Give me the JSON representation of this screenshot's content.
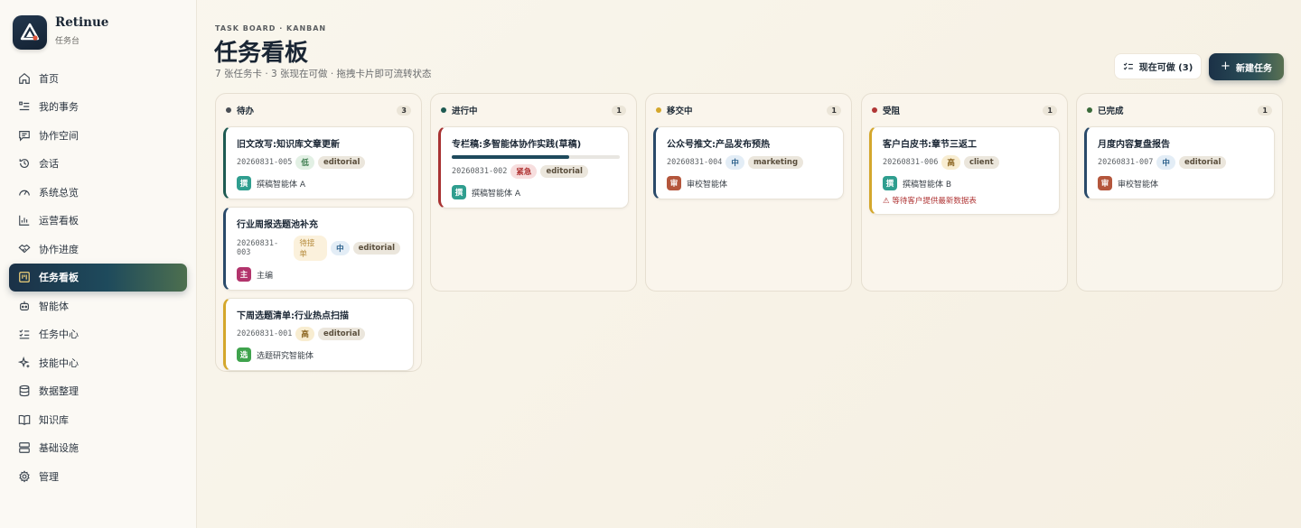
{
  "app": {
    "name": "Retinue",
    "subtitle": "任务台"
  },
  "sidebar": {
    "items": [
      {
        "label": "首页",
        "icon": "home-icon"
      },
      {
        "label": "我的事务",
        "icon": "list-icon"
      },
      {
        "label": "协作空间",
        "icon": "chat-icon"
      },
      {
        "label": "会话",
        "icon": "history-icon"
      },
      {
        "label": "系统总览",
        "icon": "gauge-icon"
      },
      {
        "label": "运营看板",
        "icon": "bar-chart-icon"
      },
      {
        "label": "协作进度",
        "icon": "handshake-icon"
      },
      {
        "label": "任务看板",
        "icon": "kanban-icon",
        "active": true
      },
      {
        "label": "智能体",
        "icon": "bot-icon"
      },
      {
        "label": "任务中心",
        "icon": "checklist-icon"
      },
      {
        "label": "技能中心",
        "icon": "sparkles-icon"
      },
      {
        "label": "数据整理",
        "icon": "database-icon"
      },
      {
        "label": "知识库",
        "icon": "book-icon"
      },
      {
        "label": "基础设施",
        "icon": "server-icon"
      },
      {
        "label": "管理",
        "icon": "gear-icon"
      }
    ]
  },
  "header": {
    "eyebrow": "TASK BOARD · KANBAN",
    "title": "任务看板",
    "subtitle": "7 张任务卡 · 3 张现在可做 · 拖拽卡片即可流转状态",
    "now_button": "现在可做 (3)",
    "new_button": "新建任务"
  },
  "board": {
    "columns": [
      {
        "name": "待办",
        "count": "3",
        "color": "#4a4f55",
        "cards": [
          {
            "title": "旧文改写:知识库文章更新",
            "code": "20260831-005",
            "tags": [
              {
                "text": "低",
                "kind": "low"
              },
              {
                "text": "editorial",
                "kind": "domain"
              }
            ],
            "owner": "撰稿智能体 A",
            "avatar": "撰",
            "avatar_color": "#2f9e8f",
            "border": "#1e5a52"
          },
          {
            "title": "行业周报选题池补充",
            "code": "20260831-003",
            "tags": [
              {
                "text": "待接单",
                "kind": "pending"
              },
              {
                "text": "中",
                "kind": "mid"
              },
              {
                "text": "editorial",
                "kind": "domain"
              }
            ],
            "owner": "主编",
            "avatar": "主",
            "avatar_color": "#b2346c",
            "border": "#2a4a6a"
          },
          {
            "title": "下周选题清单:行业热点扫描",
            "code": "20260831-001",
            "tags": [
              {
                "text": "高",
                "kind": "high"
              },
              {
                "text": "editorial",
                "kind": "domain"
              }
            ],
            "owner": "选题研究智能体",
            "avatar": "选",
            "avatar_color": "#3fa34d",
            "border": "#d4a72c"
          }
        ]
      },
      {
        "name": "进行中",
        "count": "1",
        "color": "#1e5a52",
        "cards": [
          {
            "title": "专栏稿:多智能体协作实践(草稿)",
            "code": "20260831-002",
            "progress": 0.7,
            "tags": [
              {
                "text": "紧急",
                "kind": "urgent"
              },
              {
                "text": "editorial",
                "kind": "domain"
              }
            ],
            "owner": "撰稿智能体 A",
            "avatar": "撰",
            "avatar_color": "#2f9e8f",
            "border": "#a83232"
          }
        ]
      },
      {
        "name": "移交中",
        "count": "1",
        "color": "#d4a72c",
        "cards": [
          {
            "title": "公众号推文:产品发布预热",
            "code": "20260831-004",
            "tags": [
              {
                "text": "中",
                "kind": "mid"
              },
              {
                "text": "marketing",
                "kind": "domain"
              }
            ],
            "owner": "审校智能体",
            "avatar": "审",
            "avatar_color": "#b4563c",
            "border": "#2a4a6a"
          }
        ]
      },
      {
        "name": "受阻",
        "count": "1",
        "color": "#b03636",
        "cards": [
          {
            "title": "客户白皮书:章节三返工",
            "code": "20260831-006",
            "tags": [
              {
                "text": "高",
                "kind": "high"
              },
              {
                "text": "client",
                "kind": "domain"
              }
            ],
            "owner": "撰稿智能体 B",
            "avatar": "撰",
            "avatar_color": "#2f9e8f",
            "border": "#d4a72c",
            "warning": "⚠ 等待客户提供最新数据表"
          }
        ]
      },
      {
        "name": "已完成",
        "count": "1",
        "color": "#3a6a3a",
        "cards": [
          {
            "title": "月度内容复盘报告",
            "code": "20260831-007",
            "tags": [
              {
                "text": "中",
                "kind": "mid"
              },
              {
                "text": "editorial",
                "kind": "domain"
              }
            ],
            "owner": "审校智能体",
            "avatar": "审",
            "avatar_color": "#b4563c",
            "border": "#2a4a6a"
          }
        ]
      }
    ]
  }
}
